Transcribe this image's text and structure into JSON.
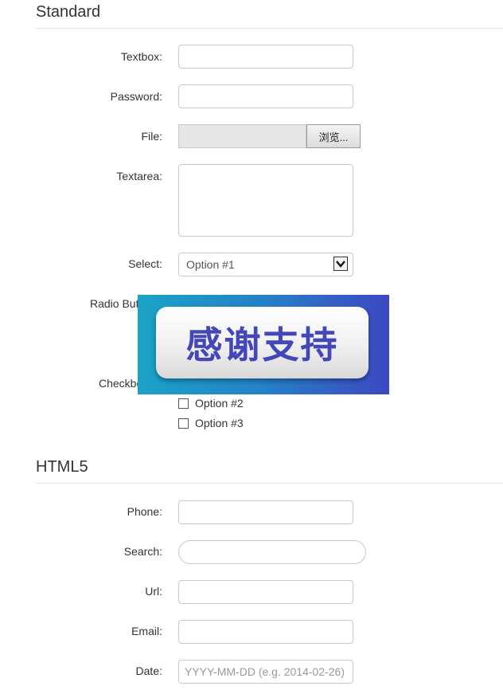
{
  "sections": {
    "standard": {
      "title": "Standard"
    },
    "html5": {
      "title": "HTML5"
    }
  },
  "standard_form": {
    "textbox": {
      "label": "Textbox:",
      "value": ""
    },
    "password": {
      "label": "Password:",
      "value": ""
    },
    "file": {
      "label": "File:",
      "button_label": "浏览..."
    },
    "textarea": {
      "label": "Textarea:",
      "value": ""
    },
    "select": {
      "label": "Select:",
      "selected": "Option #1"
    },
    "radio": {
      "label": "Radio Butt"
    },
    "checkboxes": {
      "label": "Checkbo",
      "options": [
        {
          "label": "Option #2",
          "checked": false
        },
        {
          "label": "Option #3",
          "checked": false
        }
      ]
    }
  },
  "html5_form": {
    "phone": {
      "label": "Phone:",
      "value": ""
    },
    "search": {
      "label": "Search:",
      "value": ""
    },
    "url": {
      "label": "Url:",
      "value": ""
    },
    "email": {
      "label": "Email:",
      "value": ""
    },
    "date": {
      "label": "Date:",
      "placeholder": "YYYY-MM-DD (e.g. 2014-02-26)"
    }
  },
  "overlay": {
    "text": "感谢支持"
  },
  "colors": {
    "overlay_gradient_start": "#1aa3c7",
    "overlay_gradient_end": "#3d48c2",
    "overlay_text": "#4447b8"
  }
}
